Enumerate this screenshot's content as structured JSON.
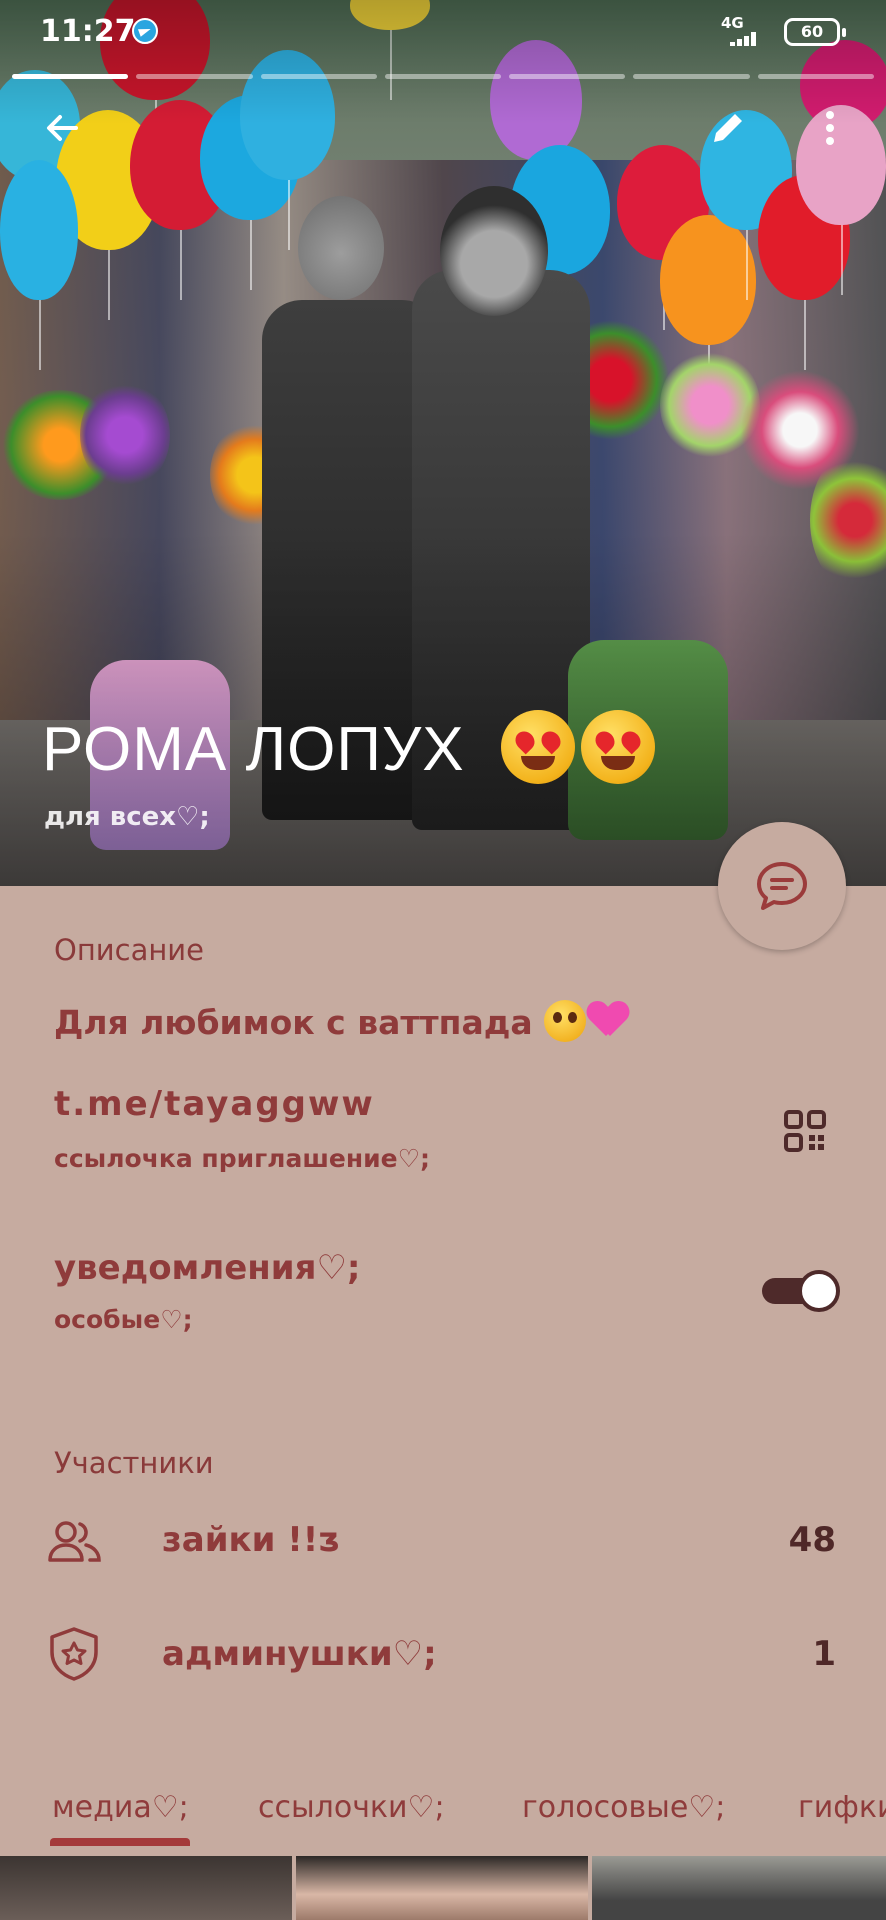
{
  "status_bar": {
    "time": "11:27",
    "network": "4G",
    "battery": "60"
  },
  "header": {
    "title": "РОМА ЛОПУХ",
    "subtitle": "для всех♡;",
    "back_icon": "arrow-left-icon",
    "edit_icon": "pencil-icon",
    "more_icon": "more-vertical-icon"
  },
  "info": {
    "description_label": "Описание",
    "description_text": "Для любимок с ваттпада",
    "link": {
      "url": "t.me/tayaggww",
      "caption": "ссылочка приглашение♡;"
    },
    "notifications": {
      "title": "уведомления♡;",
      "subtitle": "особые♡;",
      "enabled": true
    }
  },
  "members": {
    "label": "Участники",
    "rows": [
      {
        "label": "зайки !!ᴣ",
        "count": "48",
        "icon": "people-icon"
      },
      {
        "label": "админушки♡;",
        "count": "1",
        "icon": "shield-star-icon"
      }
    ]
  },
  "tabs": [
    {
      "label": "медиа♡;"
    },
    {
      "label": "ссылочки♡;"
    },
    {
      "label": "голосовые♡;"
    },
    {
      "label": "гифки"
    }
  ],
  "colors": {
    "panel_bg": "#c6aba0",
    "accent_text": "#8f3b3b",
    "dark_accent": "#4e2a2a"
  }
}
